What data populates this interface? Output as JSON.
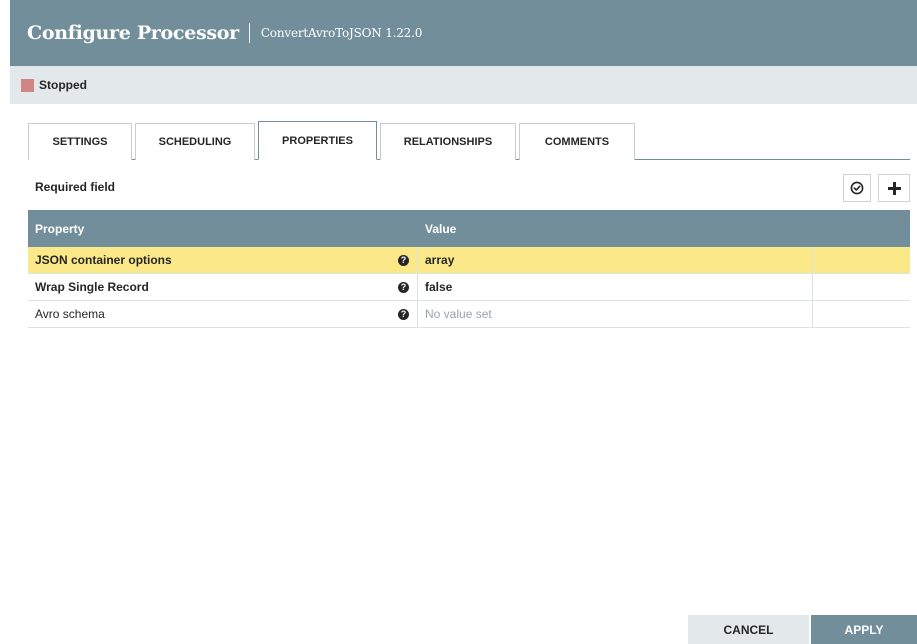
{
  "header": {
    "title": "Configure Processor",
    "subtitle": "ConvertAvroToJSON 1.22.0"
  },
  "status": {
    "text": "Stopped",
    "color": "#d18686"
  },
  "tabs": [
    {
      "label": "SETTINGS"
    },
    {
      "label": "SCHEDULING"
    },
    {
      "label": "PROPERTIES",
      "active": true
    },
    {
      "label": "RELATIONSHIPS"
    },
    {
      "label": "COMMENTS"
    }
  ],
  "required_label": "Required field",
  "toolbar": {
    "verify_icon": "check-circle-icon",
    "add_icon": "plus-icon"
  },
  "table": {
    "columns": [
      "Property",
      "Value"
    ],
    "rows": [
      {
        "property": "JSON container options",
        "value": "array",
        "required": true,
        "selected": true
      },
      {
        "property": "Wrap Single Record",
        "value": "false",
        "required": true
      },
      {
        "property": "Avro schema",
        "value": "No value set",
        "required": false,
        "empty": true
      }
    ]
  },
  "footer": {
    "cancel_label": "CANCEL",
    "apply_label": "APPLY"
  },
  "colors": {
    "header_bg": "#728e9b",
    "selected_row": "#fbe989"
  }
}
